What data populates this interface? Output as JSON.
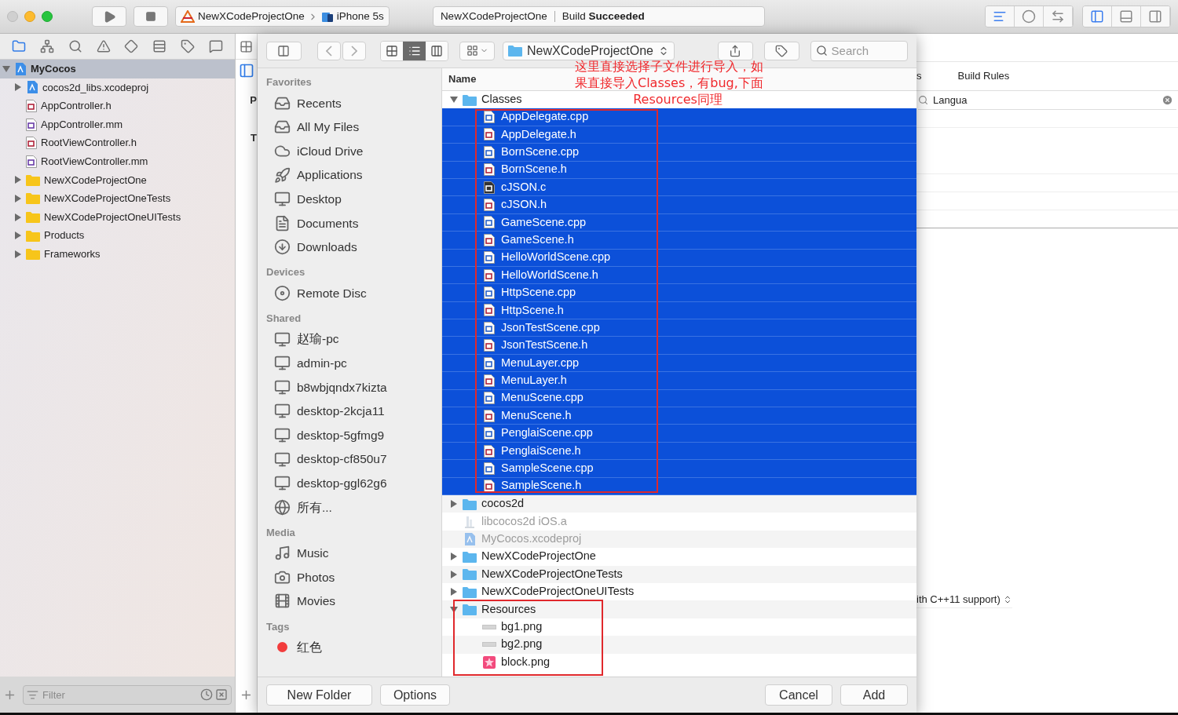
{
  "toolbar": {
    "scheme": {
      "project": "NewXCodeProjectOne",
      "device": "iPhone 5s"
    },
    "status": {
      "project": "NewXCodeProjectOne",
      "message": "Build **Succeeded**"
    },
    "editor_modes": [
      {
        "kind": "standard",
        "selected": true
      },
      {
        "kind": "assistant",
        "selected": false
      },
      {
        "kind": "version",
        "selected": false
      }
    ],
    "panels": [
      {
        "kind": "left",
        "selected": true
      },
      {
        "kind": "bottom",
        "selected": false
      },
      {
        "kind": "right",
        "selected": false
      }
    ]
  },
  "navigator": {
    "tabs": [
      {
        "kind": "project",
        "selected": true
      },
      {
        "kind": "symbol",
        "selected": false
      },
      {
        "kind": "find",
        "selected": false
      },
      {
        "kind": "issue",
        "selected": false
      },
      {
        "kind": "test",
        "selected": false
      },
      {
        "kind": "debug",
        "selected": false
      },
      {
        "kind": "breakpoint",
        "selected": false
      },
      {
        "kind": "report",
        "selected": false
      }
    ],
    "tree": [
      {
        "name": "MyCocos",
        "kind": "xcodeproj",
        "expanded": true,
        "selected": true,
        "children": [
          {
            "name": "cocos2d_libs.xcodeproj",
            "kind": "xcodeproj",
            "expanded": false,
            "selected": false
          },
          {
            "name": "AppController.h",
            "kind": "h",
            "selected": false
          },
          {
            "name": "AppController.mm",
            "kind": "m",
            "selected": false
          },
          {
            "name": "RootViewController.h",
            "kind": "h",
            "selected": false
          },
          {
            "name": "RootViewController.mm",
            "kind": "m",
            "selected": false
          },
          {
            "name": "NewXCodeProjectOne",
            "kind": "folder",
            "expanded": false,
            "selected": false
          },
          {
            "name": "NewXCodeProjectOneTests",
            "kind": "folder",
            "expanded": false,
            "selected": false
          },
          {
            "name": "NewXCodeProjectOneUITests",
            "kind": "folder",
            "expanded": false,
            "selected": false
          },
          {
            "name": "Products",
            "kind": "folder",
            "expanded": false,
            "selected": false
          },
          {
            "name": "Frameworks",
            "kind": "folder",
            "expanded": false,
            "selected": false
          }
        ]
      }
    ],
    "filter": {
      "placeholder": "Filter"
    }
  },
  "editor": {
    "cut_letters": [
      "P",
      "T"
    ],
    "tab_fragment": "s",
    "tab": "Build Rules",
    "filter": {
      "value": "Langua"
    },
    "setting_fragment": "ith C++11 support)"
  },
  "dialog": {
    "location": "NewXCodeProjectOne",
    "search": {
      "placeholder": "Search"
    },
    "view_modes": [
      {
        "kind": "icons",
        "selected": false
      },
      {
        "kind": "list",
        "selected": true
      },
      {
        "kind": "columns",
        "selected": false
      }
    ],
    "sidebar": [
      {
        "title": "Favorites",
        "items": [
          {
            "label": "Recents",
            "kind": "recents"
          },
          {
            "label": "All My Files",
            "kind": "recents"
          },
          {
            "label": "iCloud Drive",
            "kind": "cloud"
          },
          {
            "label": "Applications",
            "kind": "apps"
          },
          {
            "label": "Desktop",
            "kind": "desktop"
          },
          {
            "label": "Documents",
            "kind": "document"
          },
          {
            "label": "Downloads",
            "kind": "download"
          }
        ]
      },
      {
        "title": "Devices",
        "items": [
          {
            "label": "Remote Disc",
            "kind": "disc"
          }
        ]
      },
      {
        "title": "Shared",
        "items": [
          {
            "label": "赵瑜-pc",
            "kind": "computer"
          },
          {
            "label": "admin-pc",
            "kind": "computer"
          },
          {
            "label": "b8wbjqndx7kizta",
            "kind": "computer"
          },
          {
            "label": "desktop-2kcja11",
            "kind": "computer"
          },
          {
            "label": "desktop-5gfmg9",
            "kind": "computer"
          },
          {
            "label": "desktop-cf850u7",
            "kind": "computer"
          },
          {
            "label": "desktop-ggl62g6",
            "kind": "computer"
          },
          {
            "label": "所有...",
            "kind": "network"
          }
        ]
      },
      {
        "title": "Media",
        "items": [
          {
            "label": "Music",
            "kind": "music"
          },
          {
            "label": "Photos",
            "kind": "photo"
          },
          {
            "label": "Movies",
            "kind": "movie"
          }
        ]
      },
      {
        "title": "Tags",
        "items": [
          {
            "label": "红色",
            "kind": "tag",
            "color": "#f23c3c"
          }
        ]
      }
    ],
    "column": "Name",
    "files": [
      {
        "name": "Classes",
        "kind": "folder",
        "expanded": true,
        "selected": false,
        "disabled": false,
        "children": [
          {
            "name": "AppDelegate.cpp",
            "kind": "cpp",
            "selected": true,
            "disabled": false
          },
          {
            "name": "AppDelegate.h",
            "kind": "h",
            "selected": true,
            "disabled": false
          },
          {
            "name": "BornScene.cpp",
            "kind": "cpp",
            "selected": true,
            "disabled": false
          },
          {
            "name": "BornScene.h",
            "kind": "h",
            "selected": true,
            "disabled": false
          },
          {
            "name": "cJSON.c",
            "kind": "c",
            "selected": true,
            "disabled": false
          },
          {
            "name": "cJSON.h",
            "kind": "h",
            "selected": true,
            "disabled": false
          },
          {
            "name": "GameScene.cpp",
            "kind": "cpp",
            "selected": true,
            "disabled": false
          },
          {
            "name": "GameScene.h",
            "kind": "h",
            "selected": true,
            "disabled": false
          },
          {
            "name": "HelloWorldScene.cpp",
            "kind": "cpp",
            "selected": true,
            "disabled": false
          },
          {
            "name": "HelloWorldScene.h",
            "kind": "h",
            "selected": true,
            "disabled": false
          },
          {
            "name": "HttpScene.cpp",
            "kind": "cpp",
            "selected": true,
            "disabled": false
          },
          {
            "name": "HttpScene.h",
            "kind": "h",
            "selected": true,
            "disabled": false
          },
          {
            "name": "JsonTestScene.cpp",
            "kind": "cpp",
            "selected": true,
            "disabled": false
          },
          {
            "name": "JsonTestScene.h",
            "kind": "h",
            "selected": true,
            "disabled": false
          },
          {
            "name": "MenuLayer.cpp",
            "kind": "cpp",
            "selected": true,
            "disabled": false
          },
          {
            "name": "MenuLayer.h",
            "kind": "h",
            "selected": true,
            "disabled": false
          },
          {
            "name": "MenuScene.cpp",
            "kind": "cpp",
            "selected": true,
            "disabled": false
          },
          {
            "name": "MenuScene.h",
            "kind": "h",
            "selected": true,
            "disabled": false
          },
          {
            "name": "PenglaiScene.cpp",
            "kind": "cpp",
            "selected": true,
            "disabled": false
          },
          {
            "name": "PenglaiScene.h",
            "kind": "h",
            "selected": true,
            "disabled": false
          },
          {
            "name": "SampleScene.cpp",
            "kind": "cpp",
            "selected": true,
            "disabled": false
          },
          {
            "name": "SampleScene.h",
            "kind": "h",
            "selected": true,
            "disabled": false
          }
        ]
      },
      {
        "name": "cocos2d",
        "kind": "folder",
        "expanded": false,
        "selected": false,
        "disabled": false
      },
      {
        "name": "libcocos2d iOS.a",
        "kind": "lib",
        "selected": false,
        "disabled": true
      },
      {
        "name": "MyCocos.xcodeproj",
        "kind": "xcodeproj",
        "selected": false,
        "disabled": true
      },
      {
        "name": "NewXCodeProjectOne",
        "kind": "folder",
        "expanded": false,
        "selected": false,
        "disabled": false
      },
      {
        "name": "NewXCodeProjectOneTests",
        "kind": "folder",
        "expanded": false,
        "selected": false,
        "disabled": false
      },
      {
        "name": "NewXCodeProjectOneUITests",
        "kind": "folder",
        "expanded": false,
        "selected": false,
        "disabled": false
      },
      {
        "name": "Resources",
        "kind": "folder",
        "expanded": true,
        "selected": false,
        "disabled": false,
        "children": [
          {
            "name": "bg1.png",
            "kind": "image-strip",
            "selected": false,
            "disabled": false
          },
          {
            "name": "bg2.png",
            "kind": "image-strip",
            "selected": false,
            "disabled": false
          },
          {
            "name": "block.png",
            "kind": "image-star",
            "selected": false,
            "disabled": false
          }
        ]
      }
    ],
    "annotation": [
      "这里直接选择子文件进行导入，如",
      "果直接导入Classes，有bug,下面",
      "Resources同理"
    ],
    "buttons_left": [
      "New Folder",
      "Options"
    ],
    "buttons_right": [
      "Cancel",
      "Add"
    ]
  }
}
